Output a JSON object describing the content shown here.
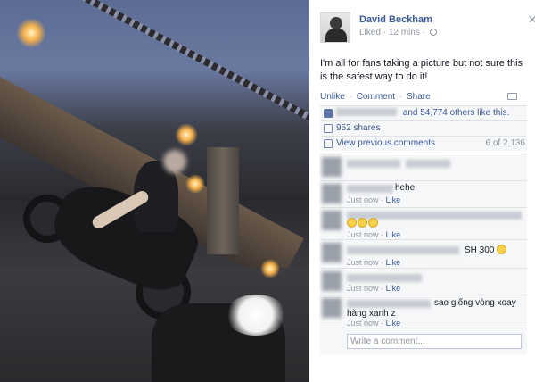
{
  "post": {
    "author": "David Beckham",
    "liked_label": "Liked",
    "separator": "·",
    "time": "12 mins",
    "status_text": "I'm all for fans taking a picture but not sure this is the safest way to do it!",
    "actions": {
      "unlike": "Unlike",
      "comment": "Comment",
      "share": "Share"
    },
    "likes_text": "and 54,774 others like this.",
    "shares_text": "952 shares",
    "view_previous": "View previous comments",
    "pager": "6 of 2,136"
  },
  "comments": [
    {
      "text": "",
      "time": "",
      "like": ""
    },
    {
      "text": "hehe",
      "time": "Just now",
      "like": "Like"
    },
    {
      "text": "",
      "time": "Just now",
      "like": "Like"
    },
    {
      "text": "SH 300",
      "time": "Just now",
      "like": "Like"
    },
    {
      "text": "",
      "time": "Just now",
      "like": "Like"
    },
    {
      "text": "sao giống vòng xoay",
      "text2": "hàng xanh z",
      "time": "Just now",
      "like": "Like"
    }
  ],
  "composer": {
    "placeholder": "Write a comment..."
  },
  "icons": {
    "close": "close-icon",
    "globe": "globe-icon",
    "share": "share-icon",
    "like": "like-icon",
    "shares": "shares-icon",
    "comments": "comments-icon",
    "emoji": "emoji-icon"
  },
  "colors": {
    "link": "#3b5998",
    "meta": "#9197a3",
    "panel": "#f6f7f8"
  }
}
